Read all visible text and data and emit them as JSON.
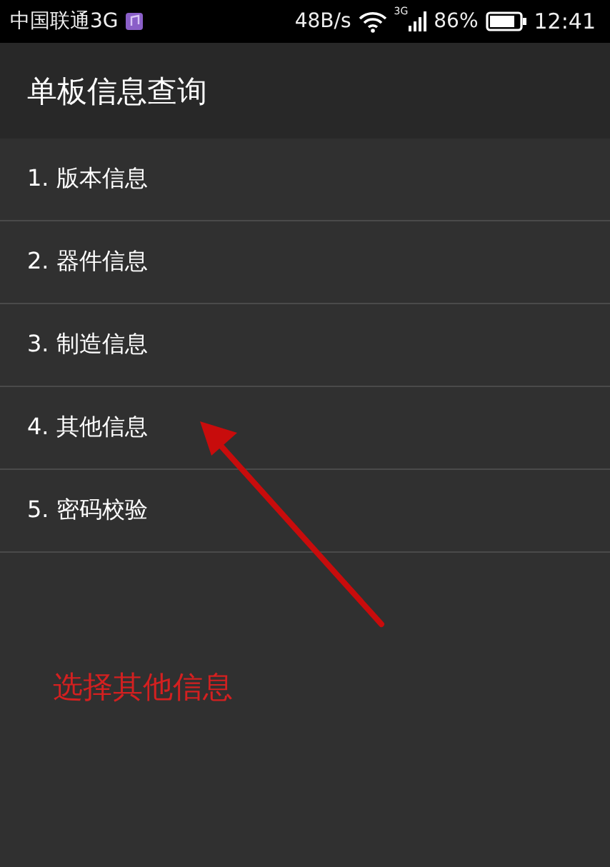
{
  "status_bar": {
    "carrier": "中国联通3G",
    "speed": "48B/s",
    "network": "3G",
    "battery": "86%",
    "time": "12:41"
  },
  "header": {
    "title": "单板信息查询"
  },
  "menu": [
    {
      "label": "1. 版本信息"
    },
    {
      "label": "2. 器件信息"
    },
    {
      "label": "3. 制造信息"
    },
    {
      "label": "4. 其他信息"
    },
    {
      "label": "5. 密码校验"
    }
  ],
  "annotation": {
    "text": "选择其他信息"
  }
}
